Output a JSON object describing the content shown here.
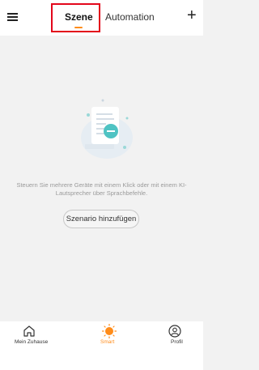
{
  "header": {
    "tabs": [
      {
        "label": "Szene",
        "active": true
      },
      {
        "label": "Automation",
        "active": false
      }
    ],
    "menu_icon": "hamburger-menu-icon",
    "add_icon": "plus-icon",
    "accent_color": "#ff8c1a",
    "highlight_color": "#e3061b"
  },
  "main": {
    "empty_message": "Steuern Sie mehrere Geräte mit einem Klick oder mit einem KI-Lautsprecher über Sprachbefehle.",
    "add_button_label": "Szenario hinzufügen",
    "illustration_icon": "document-illustration"
  },
  "bottom_nav": {
    "items": [
      {
        "label": "Mein Zuhause",
        "icon": "home-icon",
        "active": false
      },
      {
        "label": "Smart",
        "icon": "sun-icon",
        "active": true
      },
      {
        "label": "Profil",
        "icon": "user-icon",
        "active": false
      }
    ]
  }
}
